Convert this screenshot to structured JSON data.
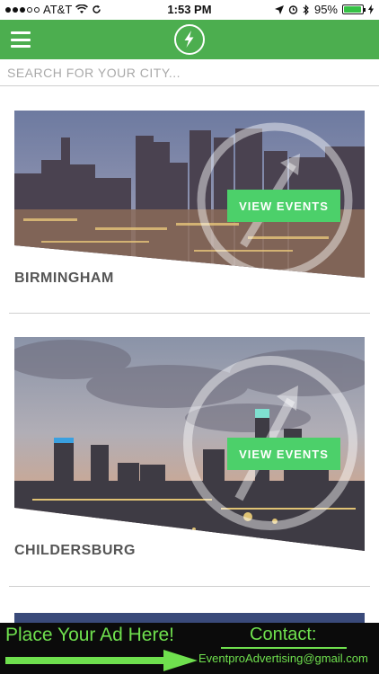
{
  "status_bar": {
    "carrier": "AT&T",
    "time": "1:53 PM",
    "battery_percent": "95%",
    "battery_level": 0.95
  },
  "app_bar": {
    "menu_icon": "hamburger-menu-icon",
    "logo_icon": "lightning-bolt-icon",
    "accent_color": "#4cae4f"
  },
  "search": {
    "placeholder": "SEARCH FOR YOUR CITY...",
    "value": ""
  },
  "cities": [
    {
      "name": "BIRMINGHAM",
      "button_label": "VIEW EVENTS"
    },
    {
      "name": "CHILDERSBURG",
      "button_label": "VIEW EVENTS"
    }
  ],
  "ad_banner": {
    "headline": "Place Your Ad Here!",
    "contact_title": "Contact:",
    "contact_email": "EventproAdvertising@gmail.com",
    "accent_color": "#6fe04e"
  }
}
